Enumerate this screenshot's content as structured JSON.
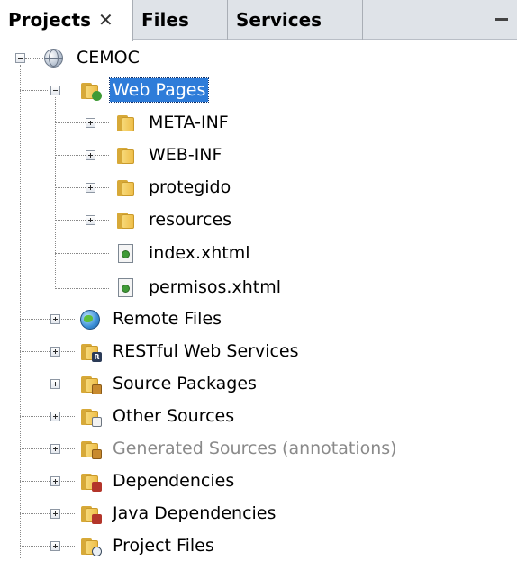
{
  "tabs": [
    {
      "label": "Projects",
      "close": "✕",
      "active": true
    },
    {
      "label": "Files",
      "active": false
    },
    {
      "label": "Services",
      "active": false
    }
  ],
  "minimize_symbol": "—",
  "tree": {
    "root": {
      "label": "CEMOC",
      "icon": "project-globe-icon"
    },
    "web_pages": {
      "label": "Web Pages",
      "icon": "web-pages-folder-icon",
      "selected": true
    },
    "web_children": [
      {
        "label": "META-INF",
        "icon": "folder-icon"
      },
      {
        "label": "WEB-INF",
        "icon": "folder-icon"
      },
      {
        "label": "protegido",
        "icon": "folder-icon"
      },
      {
        "label": "resources",
        "icon": "folder-icon"
      },
      {
        "label": "index.xhtml",
        "icon": "xhtml-file-icon"
      },
      {
        "label": "permisos.xhtml",
        "icon": "xhtml-file-icon"
      }
    ],
    "top_items": [
      {
        "label": "Remote Files",
        "icon": "remote-files-icon"
      },
      {
        "label": "RESTful Web Services",
        "icon": "restful-folder-icon",
        "badge": "R"
      },
      {
        "label": "Source Packages",
        "icon": "source-packages-icon"
      },
      {
        "label": "Other Sources",
        "icon": "other-sources-icon"
      },
      {
        "label": "Generated Sources (annotations)",
        "icon": "generated-sources-icon",
        "dim": true
      },
      {
        "label": "Dependencies",
        "icon": "dependencies-icon"
      },
      {
        "label": "Java Dependencies",
        "icon": "java-dependencies-icon"
      },
      {
        "label": "Project Files",
        "icon": "project-files-icon"
      }
    ]
  },
  "colors": {
    "selection": "#2e7cd9",
    "tabbar": "#dfe3e8",
    "folder": "#eebd47",
    "dim_text": "#8a8a8a"
  }
}
